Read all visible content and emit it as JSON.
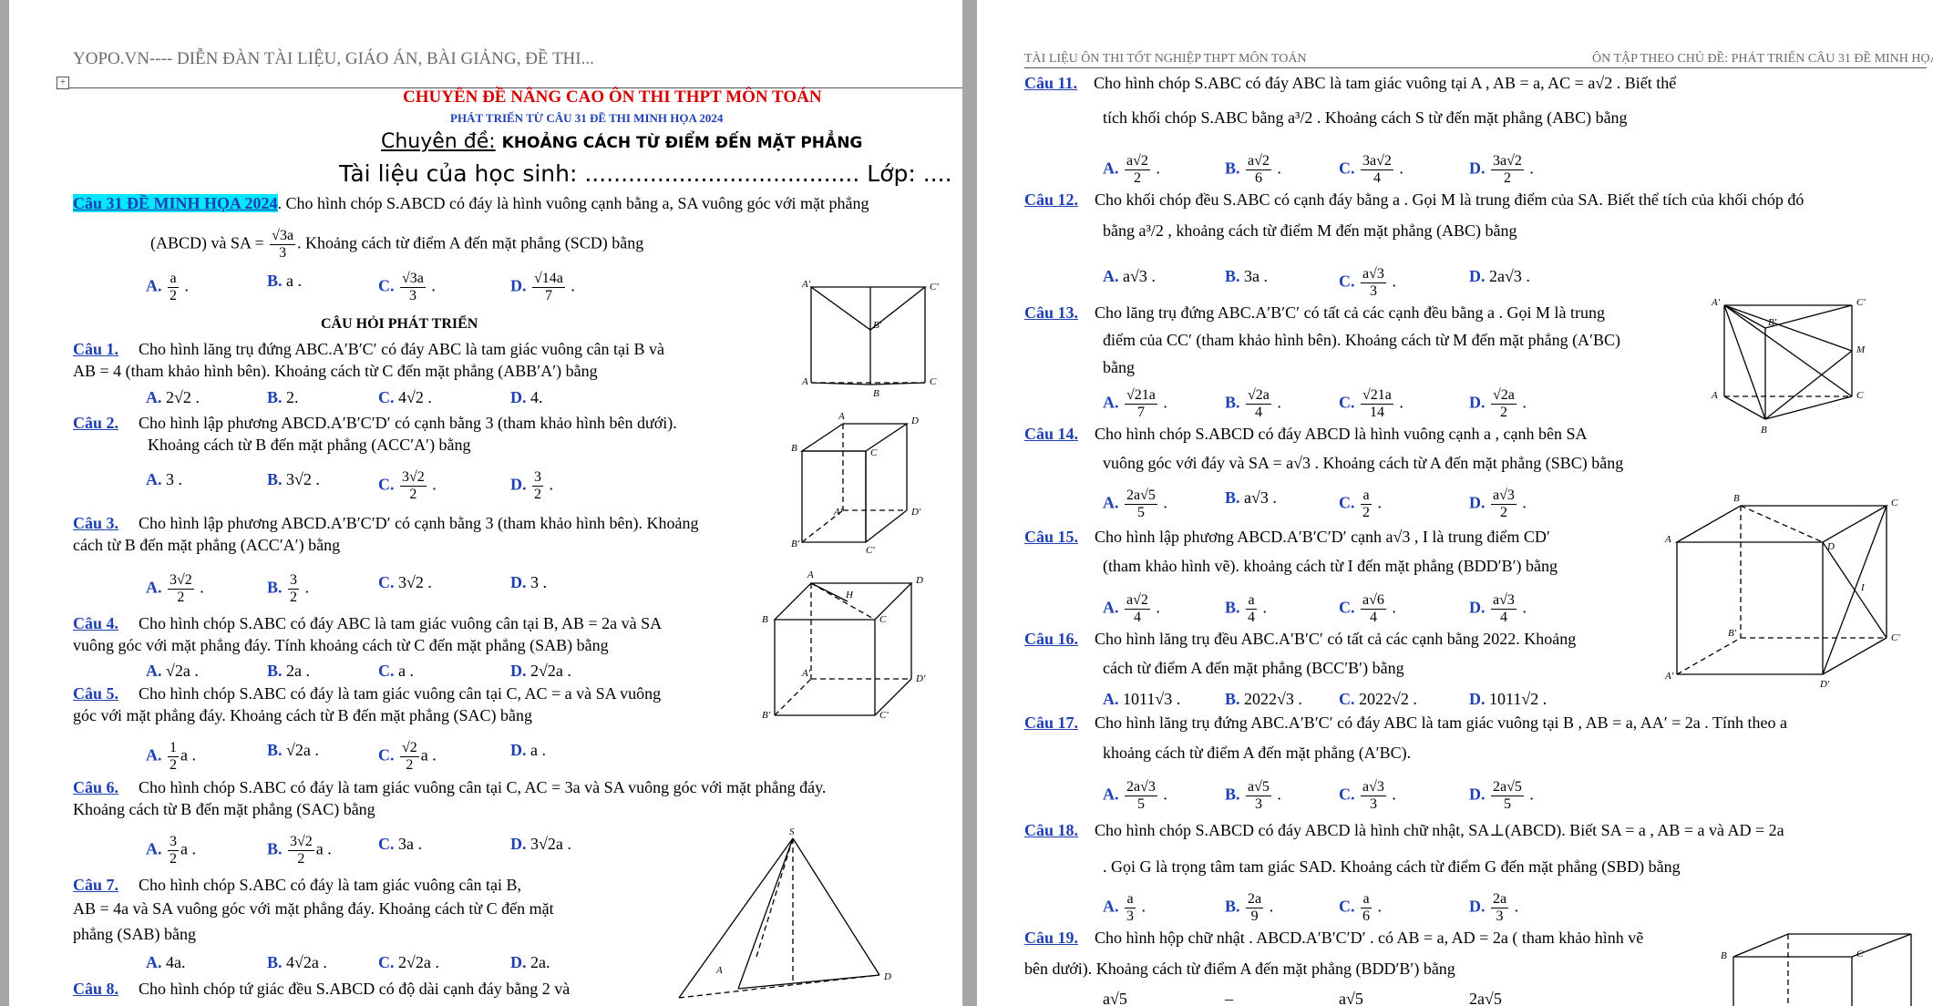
{
  "left_page": {
    "header": "YOPO.VN---- DIỄN ĐÀN TÀI LIỆU, GIÁO ÁN, BÀI GIẢNG, ĐỀ THI...",
    "anchor": "+",
    "title1": "CHUYÊN ĐỀ NÂNG CAO ÔN THI THPT MÔN TOÁN",
    "title2": "PHÁT TRIỂN TỪ CÂU 31 ĐỀ THI MINH HỌA 2024",
    "title3_label": "Chuyên đề:",
    "title3_text": "KHOẢNG CÁCH TỪ ĐIỂM ĐẾN MẶT PHẲNG",
    "student_line": "Tài liệu của học sinh: ...................................... Lớp: ....",
    "main_q_label": "Câu 31 ĐỀ MINH HỌA 2024",
    "main_q_text1": ". Cho hình chóp S.ABCD có đáy là hình vuông cạnh bằng a, SA vuông góc với mặt phẳng",
    "main_q_text2a": "(ABCD) và SA =",
    "main_q_frac_n": "√3a",
    "main_q_frac_d": "3",
    "main_q_text2b": ". Khoảng cách từ điểm A đến mặt phẳng (SCD) bằng",
    "main_opts": [
      {
        "l": "A.",
        "n": "a",
        "d": "2"
      },
      {
        "l": "B.",
        "t": "a ."
      },
      {
        "l": "C.",
        "n": "√3a",
        "d": "3"
      },
      {
        "l": "D.",
        "n": "√14a",
        "d": "7"
      }
    ],
    "section_title": "CÂU HỎI PHÁT TRIỂN",
    "questions": [
      {
        "label": "Câu 1.",
        "lines": [
          "Cho hình lăng trụ đứng ABC.A′B′C′ có đáy ABC là tam giác vuông cân tại B và",
          "AB = 4 (tham khảo hình bên). Khoảng cách từ C đến mặt phẳng (ABB′A′) bằng"
        ]
      },
      {
        "label": "Câu 2.",
        "lines": [
          "Cho hình lập phương ABCD.A′B′C′D′ có cạnh bằng 3 (tham khảo hình bên dưới).",
          "Khoảng cách từ B đến mặt phẳng (ACC′A′) bằng"
        ]
      },
      {
        "label": "Câu 3.",
        "lines": [
          "Cho hình lập phương ABCD.A′B′C′D′ có cạnh bằng 3 (tham khảo hình bên). Khoảng",
          "cách từ B đến mặt phẳng (ACC′A′) bằng"
        ]
      },
      {
        "label": "Câu 4.",
        "lines": [
          "Cho hình chóp S.ABC có đáy ABC là tam giác vuông cân tại B, AB = 2a và SA",
          "vuông góc với mặt phẳng đáy. Tính khoảng cách từ C đến mặt phẳng (SAB) bằng"
        ]
      },
      {
        "label": "Câu 5.",
        "lines": [
          "Cho hình chóp S.ABC có đáy là tam giác vuông cân tại C, AC = a và SA vuông",
          "góc với mặt phẳng đáy. Khoảng cách từ B đến mặt phẳng (SAC) bằng"
        ]
      },
      {
        "label": "Câu 6.",
        "lines": [
          "Cho hình chóp S.ABC có đáy là tam giác vuông cân tại C, AC = 3a và SA vuông góc với mặt phẳng đáy.",
          "Khoảng cách từ B đến mặt phẳng (SAC) bằng"
        ]
      },
      {
        "label": "Câu 7.",
        "lines": [
          "Cho hình chóp S.ABC có đáy là tam giác vuông cân tại B,",
          "AB = 4a và SA vuông góc với mặt phẳng đáy. Khoảng cách từ C đến mặt",
          "phẳng (SAB) bằng"
        ]
      },
      {
        "label": "Câu 8.",
        "lines": [
          "Cho hình chóp tứ giác đều S.ABCD có độ dài cạnh đáy bằng 2 và"
        ]
      }
    ],
    "opts": {
      "q1": [
        "A. 2√2 .",
        "B. 2.",
        "C. 4√2 .",
        "D. 4."
      ],
      "q2": [
        {
          "l": "A.",
          "t": "3 ."
        },
        {
          "l": "B.",
          "t": "3√2 ."
        },
        {
          "l": "C.",
          "n": "3√2",
          "d": "2"
        },
        {
          "l": "D.",
          "n": "3",
          "d": "2"
        }
      ],
      "q3": [
        {
          "l": "A.",
          "n": "3√2",
          "d": "2"
        },
        {
          "l": "B.",
          "n": "3",
          "d": "2"
        },
        {
          "l": "C.",
          "t": "3√2 ."
        },
        {
          "l": "D.",
          "t": "3 ."
        }
      ],
      "q4": [
        "A. √2a .",
        "B. 2a .",
        "C. a .",
        "D. 2√2a ."
      ],
      "q5": [
        {
          "l": "A.",
          "n": "1",
          "d": "2",
          "s": "a ."
        },
        {
          "l": "B.",
          "t": "√2a ."
        },
        {
          "l": "C.",
          "n": "√2",
          "d": "2",
          "s": "a ."
        },
        {
          "l": "D.",
          "t": "a ."
        }
      ],
      "q6": [
        {
          "l": "A.",
          "n": "3",
          "d": "2",
          "s": "a ."
        },
        {
          "l": "B.",
          "n": "3√2",
          "d": "2",
          "s": "a ."
        },
        {
          "l": "C.",
          "t": "3a ."
        },
        {
          "l": "D.",
          "t": "3√2a ."
        }
      ],
      "q7": [
        "A. 4a.",
        "B. 4√2a .",
        "C. 2√2a .",
        "D. 2a."
      ]
    }
  },
  "right_page": {
    "header_left": "TÀI LIỆU ÔN THI TỐT NGHIỆP THPT MÔN TOÁN",
    "header_right": "ÔN TẬP THEO CHỦ ĐỀ: PHÁT TRIỂN CÂU 31 ĐỀ MINH HỌA 2024",
    "questions": [
      {
        "label": "Câu 11.",
        "lines": [
          "Cho hình chóp S.ABC có đáy ABC là tam giác vuông tại A , AB = a, AC = a√2 . Biết thể",
          "tích khối chóp S.ABC bằng a³/2 . Khoảng cách S từ đến mặt phẳng (ABC) bằng"
        ],
        "opts": [
          {
            "l": "A.",
            "n": "a√2",
            "d": "2"
          },
          {
            "l": "B.",
            "n": "a√2",
            "d": "6"
          },
          {
            "l": "C.",
            "n": "3a√2",
            "d": "4"
          },
          {
            "l": "D.",
            "n": "3a√2",
            "d": "2"
          }
        ]
      },
      {
        "label": "Câu 12.",
        "lines": [
          "Cho khối chóp đều S.ABC có cạnh đáy bằng a . Gọi M là trung điểm của SA. Biết thể tích của khối chóp đó",
          "bằng a³/2 , khoảng cách từ điểm M đến mặt phẳng (ABC) bằng"
        ],
        "opts": [
          {
            "l": "A.",
            "t": "a√3 ."
          },
          {
            "l": "B.",
            "t": "3a ."
          },
          {
            "l": "C.",
            "n": "a√3",
            "d": "3"
          },
          {
            "l": "D.",
            "t": "2a√3 ."
          }
        ]
      },
      {
        "label": "Câu 13.",
        "lines": [
          "Cho lăng trụ đứng ABC.A′B′C′ có tất cả các cạnh đều bằng a . Gọi M là trung",
          "điểm của CC′ (tham khảo hình bên). Khoảng cách từ M đến mặt phẳng (A′BC)",
          "bằng"
        ],
        "opts": [
          {
            "l": "A.",
            "n": "√21a",
            "d": "7"
          },
          {
            "l": "B.",
            "n": "√2a",
            "d": "4"
          },
          {
            "l": "C.",
            "n": "√21a",
            "d": "14"
          },
          {
            "l": "D.",
            "n": "√2a",
            "d": "2"
          }
        ]
      },
      {
        "label": "Câu 14.",
        "lines": [
          "Cho hình chóp S.ABCD có đáy ABCD là hình vuông cạnh a , cạnh bên SA",
          "vuông góc với đáy và SA = a√3 . Khoảng cách từ A đến mặt phẳng (SBC) bằng"
        ],
        "opts": [
          {
            "l": "A.",
            "n": "2a√5",
            "d": "5"
          },
          {
            "l": "B.",
            "t": "a√3 ."
          },
          {
            "l": "C.",
            "n": "a",
            "d": "2"
          },
          {
            "l": "D.",
            "n": "a√3",
            "d": "2"
          }
        ]
      },
      {
        "label": "Câu 15.",
        "lines": [
          "Cho hình lập phương ABCD.A′B′C′D′ cạnh a√3 , I là trung điểm CD′",
          "(tham khảo hình vẽ). khoảng cách từ I đến mặt phẳng (BDD′B′) bằng"
        ],
        "opts": [
          {
            "l": "A.",
            "n": "a√2",
            "d": "4"
          },
          {
            "l": "B.",
            "n": "a",
            "d": "4"
          },
          {
            "l": "C.",
            "n": "a√6",
            "d": "4"
          },
          {
            "l": "D.",
            "n": "a√3",
            "d": "4"
          }
        ]
      },
      {
        "label": "Câu 16.",
        "lines": [
          "Cho hình lăng trụ đều ABC.A′B′C′ có tất cả các cạnh bằng 2022. Khoảng",
          "cách từ điểm A đến mặt phẳng (BCC′B′) bằng"
        ],
        "opts": [
          {
            "l": "A.",
            "t": "1011√3 ."
          },
          {
            "l": "B.",
            "t": "2022√3 ."
          },
          {
            "l": "C.",
            "t": "2022√2 ."
          },
          {
            "l": "D.",
            "t": "1011√2 ."
          }
        ]
      },
      {
        "label": "Câu 17.",
        "lines": [
          "Cho hình lăng trụ đứng ABC.A′B′C′ có đáy ABC là tam giác vuông tại B , AB = a, AA′ = 2a . Tính theo a",
          "khoảng cách từ điểm A đến mặt phẳng (A′BC)."
        ],
        "opts": [
          {
            "l": "A.",
            "n": "2a√3",
            "d": "5"
          },
          {
            "l": "B.",
            "n": "a√5",
            "d": "3"
          },
          {
            "l": "C.",
            "n": "a√3",
            "d": "3"
          },
          {
            "l": "D.",
            "n": "2a√5",
            "d": "5"
          }
        ]
      },
      {
        "label": "Câu 18.",
        "lines": [
          "Cho hình chóp S.ABCD có đáy ABCD là hình chữ nhật, SA⊥(ABCD). Biết SA = a , AB = a và AD = 2a",
          ". Gọi G là trọng tâm tam giác SAD. Khoảng cách từ điểm G đến mặt phẳng (SBD) bằng"
        ],
        "opts": [
          {
            "l": "A.",
            "n": "a",
            "d": "3"
          },
          {
            "l": "B.",
            "n": "2a",
            "d": "9"
          },
          {
            "l": "C.",
            "n": "a",
            "d": "6"
          },
          {
            "l": "D.",
            "n": "2a",
            "d": "3"
          }
        ]
      },
      {
        "label": "Câu 19.",
        "lines": [
          "Cho hình hộp chữ nhật . ABCD.A′B′C′D′ . có AB = a, AD = 2a ( tham khảo hình vẽ",
          "bên dưới). Khoảng cách từ điểm A đến mặt phẳng (BDD′B′) bằng"
        ],
        "opts": [
          {
            "l": "",
            "t": "a√5"
          },
          {
            "l": "",
            "t": "–"
          },
          {
            "l": "",
            "t": "a√5"
          },
          {
            "l": "",
            "t": "2a√5"
          }
        ]
      }
    ]
  },
  "colors": {
    "accent_blue": "#1f3fb5",
    "title_red": "#d40000",
    "highlight": "#00e7ff",
    "background": "#a6a6a6"
  }
}
